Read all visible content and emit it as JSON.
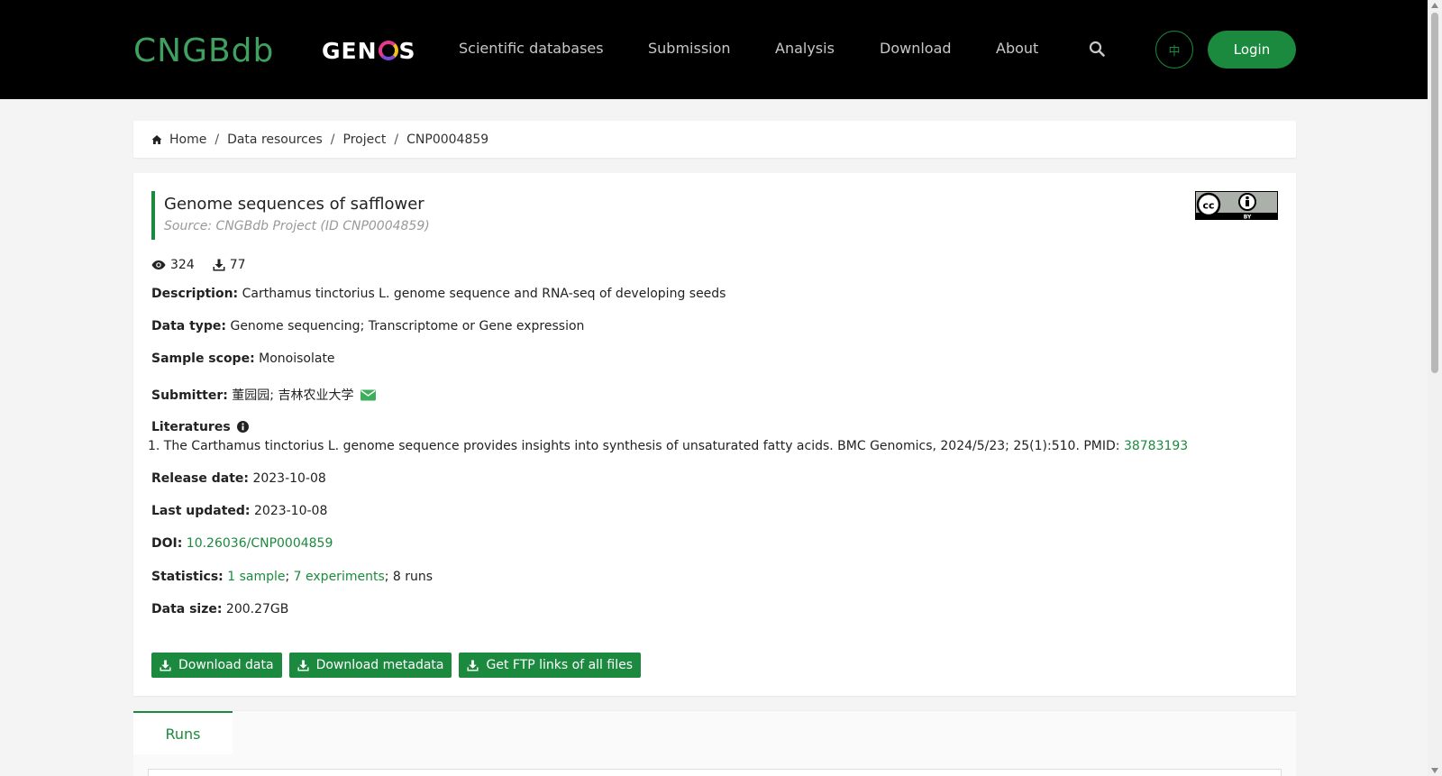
{
  "header": {
    "logo": "CNGBdb",
    "genos": {
      "pre": "GEN",
      "post": "S"
    },
    "nav": [
      "Scientific databases",
      "Submission",
      "Analysis",
      "Download",
      "About"
    ],
    "lang": "中",
    "login": "Login"
  },
  "breadcrumb": [
    "Home",
    "Data resources",
    "Project",
    "CNP0004859"
  ],
  "project": {
    "title": "Genome sequences of safflower",
    "source": "Source: CNGBdb Project (ID CNP0004859)",
    "views": "324",
    "downloads": "77",
    "description_label": "Description:",
    "description": "Carthamus tinctorius L. genome sequence and RNA-seq of developing seeds",
    "data_type_label": "Data type:",
    "data_type": "Genome sequencing; Transcriptome or Gene expression",
    "sample_scope_label": "Sample scope:",
    "sample_scope": "Monoisolate",
    "submitter_label": "Submitter:",
    "submitter": "董园园; 吉林农业大学",
    "literatures_label": "Literatures",
    "literature_1": "1. The Carthamus tinctorius L. genome sequence provides insights into synthesis of unsaturated fatty acids. BMC Genomics, 2024/5/23; 25(1):510. PMID: ",
    "literature_1_pmid": "38783193",
    "release_label": "Release date:",
    "release_date": "2023-10-08",
    "updated_label": "Last updated:",
    "last_updated": "2023-10-08",
    "doi_label": "DOI:",
    "doi": "10.26036/CNP0004859",
    "statistics_label": "Statistics:",
    "stat_samples": "1 sample",
    "stat_sep": ";",
    "stat_experiments": "7 experiments",
    "stat_runs": "; 8 runs",
    "data_size_label": "Data size:",
    "data_size": "200.27GB"
  },
  "buttons": {
    "download_data": "Download data",
    "download_metadata": "Download metadata",
    "ftp_links": "Get FTP links of all files"
  },
  "tabs": {
    "runs": "Runs"
  },
  "colors": {
    "accent": "#1c8a3e",
    "header_bg": "#000000"
  }
}
